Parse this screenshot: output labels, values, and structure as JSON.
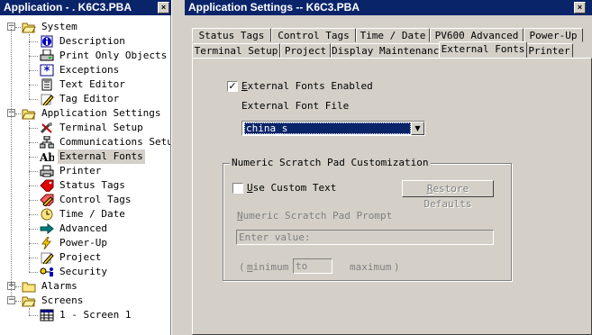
{
  "tree_window": {
    "title": "Application - . K6C3.PBA",
    "close_glyph": "×"
  },
  "tree": {
    "items": [
      {
        "label": "System",
        "icon": "folder-open-icon",
        "level": 0,
        "expander": "−"
      },
      {
        "label": "Description",
        "icon": "info-icon",
        "level": 1
      },
      {
        "label": "Print Only Objects",
        "icon": "printer-doc-icon",
        "level": 1
      },
      {
        "label": "Exceptions",
        "icon": "asterisk-icon",
        "level": 1
      },
      {
        "label": "Text Editor",
        "icon": "notepad-icon",
        "level": 1
      },
      {
        "label": "Tag Editor",
        "icon": "pencil-icon",
        "level": 1
      },
      {
        "label": "Application Settings",
        "icon": "folder-open-icon",
        "level": 0,
        "expander": "−"
      },
      {
        "label": "Terminal Setup",
        "icon": "terminal-tools-icon",
        "level": 1
      },
      {
        "label": "Communications Setup",
        "icon": "network-icon",
        "level": 1
      },
      {
        "label": "External Fonts",
        "icon": "font-ab-icon",
        "level": 1,
        "selected": true
      },
      {
        "label": "Printer",
        "icon": "printer-icon",
        "level": 1
      },
      {
        "label": "Status Tags",
        "icon": "tag-red-icon",
        "level": 1
      },
      {
        "label": "Control Tags",
        "icon": "tag-pencil-icon",
        "level": 1
      },
      {
        "label": "Time / Date",
        "icon": "clock-icon",
        "level": 1
      },
      {
        "label": "Advanced",
        "icon": "arrow-right-icon",
        "level": 1
      },
      {
        "label": "Power-Up",
        "icon": "lightning-icon",
        "level": 1
      },
      {
        "label": "Project",
        "icon": "pencil-icon",
        "level": 1
      },
      {
        "label": "Security",
        "icon": "key-people-icon",
        "level": 1
      },
      {
        "label": "Alarms",
        "icon": "folder-icon",
        "level": 0,
        "expander": "+"
      },
      {
        "label": "Screens",
        "icon": "folder-open-icon",
        "level": 0,
        "expander": "−"
      },
      {
        "label": "1 - Screen 1",
        "icon": "screen-grid-icon",
        "level": 1
      }
    ]
  },
  "dialog": {
    "title": "Application Settings -- K6C3.PBA",
    "close_glyph": "×",
    "tabs_row1": [
      "Status Tags",
      "Control Tags",
      "Time / Date",
      "PV600 Advanced",
      "Power-Up"
    ],
    "tabs_row2": [
      "Terminal Setup",
      "Project",
      "Display Maintenance",
      "External Fonts",
      "Printer"
    ],
    "active_tab": "External Fonts",
    "external_fonts_enabled_label": "External Fonts Enabled",
    "external_fonts_enabled_checked": "✓",
    "external_font_file_label": "External Font File",
    "external_font_file_value": "china_s",
    "combo_arrow": "▼",
    "scratchpad_group_title": "Numeric Scratch Pad Customization",
    "use_custom_text_label": "Use Custom Text",
    "restore_defaults_label": "Restore Defaults",
    "prompt_label": "Numeric Scratch Pad Prompt",
    "prompt_value": "Enter value:",
    "open_paren": "(",
    "minimum_label": "minimum",
    "to_value": "to",
    "maximum_label": "maximum",
    "close_paren": ")"
  }
}
